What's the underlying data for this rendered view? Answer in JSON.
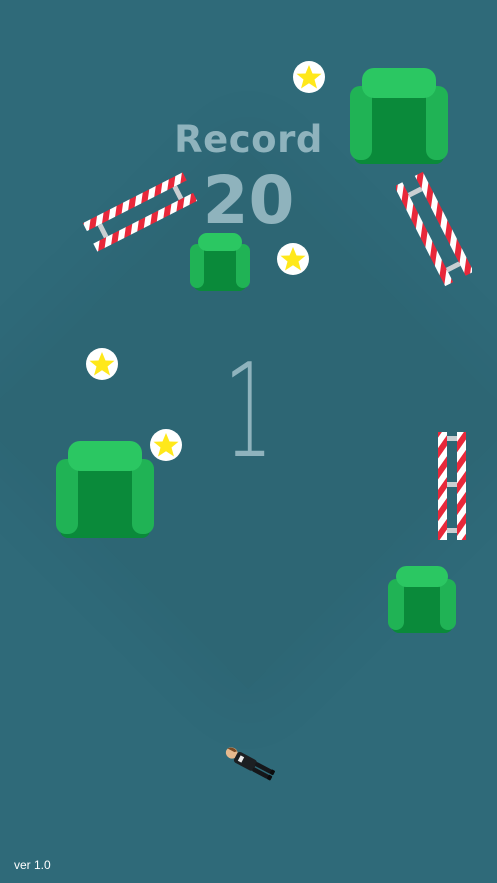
{
  "hud": {
    "record_label": "Record",
    "record_value": "20",
    "current_score": "1",
    "version": "ver 1.0"
  },
  "colors": {
    "background": "#2f6a79",
    "hud_text": "#8fb3bd",
    "chair": "#20b355",
    "star": "#ffe81a",
    "barrier_red": "#e8283a",
    "barrier_white": "#ffffff"
  },
  "objects": {
    "chairs": [
      "chair",
      "chair",
      "chair",
      "chair",
      "chair"
    ],
    "stars": [
      "star-icon",
      "star-icon",
      "star-icon",
      "star-icon"
    ],
    "barriers": [
      "striped-barrier",
      "striped-barrier",
      "striped-barrier"
    ],
    "player": "player-character"
  }
}
